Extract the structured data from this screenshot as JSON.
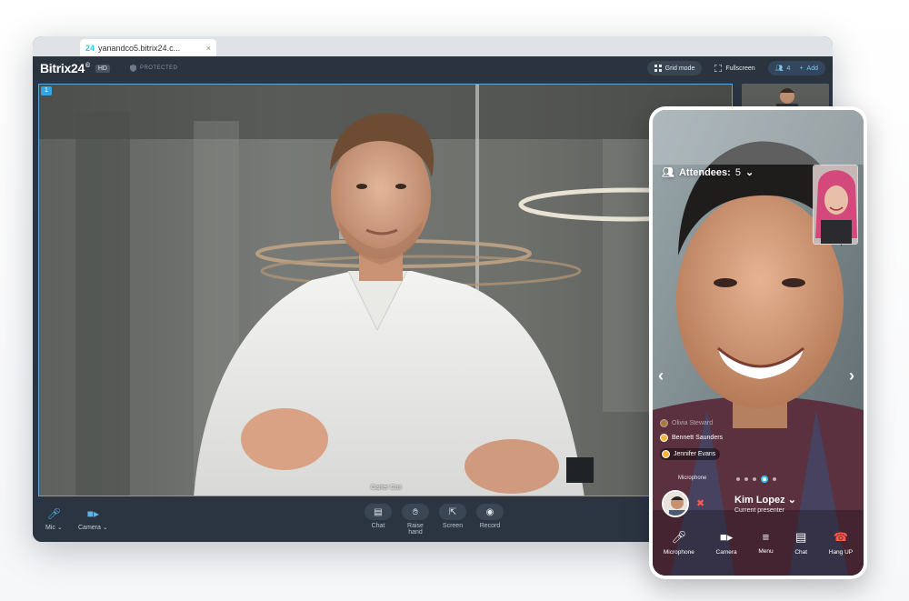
{
  "browser": {
    "tab_favicon": "24",
    "tab_title": "yanandco5.bitrix24.c...",
    "tab_close": "×"
  },
  "topbar": {
    "logo": "Bitrix24",
    "logo_mark": "©",
    "hd_badge": "HD",
    "protected": "PROTECTED",
    "grid_mode": "Grid mode",
    "fullscreen": "Fullscreen",
    "participants_count": "4",
    "add": "Add"
  },
  "video": {
    "speaker_name": "Carter Cox",
    "corner_badge": "1"
  },
  "controls": {
    "mic": "Mic",
    "camera": "Camera",
    "chat": "Chat",
    "raise_hand_line1": "Raise",
    "raise_hand_line2": "hand",
    "screen": "Screen",
    "record": "Record"
  },
  "mobile": {
    "attendees_label": "Attendees:",
    "attendees_count": "5",
    "participants": [
      {
        "name": "Olivia Steward"
      },
      {
        "name": "Bennett Saunders"
      },
      {
        "name": "Jennifer Evans"
      }
    ],
    "microphone_hint": "Microphone",
    "presenter_name": "Kim Lopez",
    "presenter_role": "Current presenter",
    "buttons": {
      "microphone": "Microphone",
      "camera": "Camera",
      "menu": "Menu",
      "chat": "Chat",
      "hang_up": "Hang UP"
    }
  },
  "colors": {
    "accent": "#2fc6f6",
    "active_border": "#58a7d8",
    "hang_up": "#ff5752",
    "toolbar_bg": "#2b3542"
  }
}
